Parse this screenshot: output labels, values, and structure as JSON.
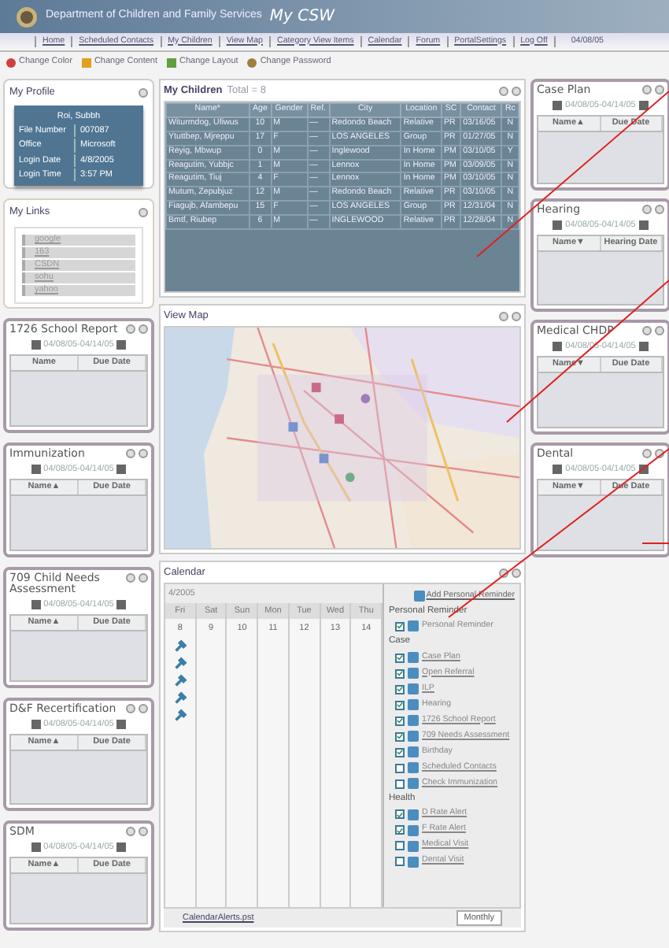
{
  "header": {
    "title": "Department of Children and Family Services",
    "app_name": "My CSW"
  },
  "nav": {
    "items": [
      "Home",
      "Scheduled Contacts",
      "My Children",
      "View Map",
      "Category View Items",
      "Calendar",
      "Forum",
      "PortalSettings",
      "Log Off"
    ],
    "date": "04/08/05"
  },
  "toolbar": [
    "Change Color",
    "Change Content",
    "Change Layout",
    "Change Password"
  ],
  "left_panels": [
    {
      "kind": "profile",
      "title": "My Profile",
      "name": "Roi, Subbh",
      "fields": [
        {
          "label": "File Number",
          "value": "007087"
        },
        {
          "label": "Office",
          "value": "Microsoft"
        },
        {
          "label": "Login Date",
          "value": "4/8/2005"
        },
        {
          "label": "Login Time",
          "value": "3:57 PM"
        }
      ]
    },
    {
      "kind": "links",
      "title": "My Links",
      "links": [
        "google",
        "163",
        "CSDN",
        "sohu",
        "yahoo"
      ]
    },
    {
      "kind": "report",
      "title": "1726 School Report",
      "range": "04/08/05-04/14/05",
      "columns": [
        "Name",
        "Due Date"
      ]
    },
    {
      "kind": "report",
      "title": "Immunization",
      "range": "04/08/05-04/14/05",
      "columns": [
        "Name▲",
        "Due Date"
      ]
    },
    {
      "kind": "report",
      "title": "709 Child Needs Assessment",
      "range": "04/08/05-04/14/05",
      "columns": [
        "Name▲",
        "Due Date"
      ]
    },
    {
      "kind": "report",
      "title": "D&F Recertification",
      "range": "04/08/05-04/14/05",
      "columns": [
        "Name▲",
        "Due Date"
      ]
    },
    {
      "kind": "report",
      "title": "SDM",
      "range": "04/08/05-04/14/05",
      "columns": [
        "Name▲",
        "Due Date"
      ]
    }
  ],
  "children": {
    "title": "My Children",
    "total": "Total = 8",
    "columns": [
      "Name*",
      "Age",
      "Gender",
      "Ref.",
      "City",
      "Location",
      "SC",
      "Contact",
      "Rc"
    ],
    "rows": [
      [
        "Witurmdog, Ufiwus",
        "10",
        "M",
        "—",
        "Redondo Beach",
        "Relative",
        "PR",
        "03/16/05",
        "N"
      ],
      [
        "Ytuttbep, Mjreppu",
        "17",
        "F",
        "—",
        "LOS ANGELES",
        "Group",
        "PR",
        "01/27/05",
        "N"
      ],
      [
        "Reyig, Mbwup",
        "0",
        "M",
        "—",
        "Inglewood",
        "In Home",
        "PM",
        "03/10/05",
        "Y"
      ],
      [
        "Reagutim, Yubbjc",
        "1",
        "M",
        "—",
        "Lennox",
        "In Home",
        "PM",
        "03/09/05",
        "N"
      ],
      [
        "Reagutim, Tiuj",
        "4",
        "F",
        "—",
        "Lennox",
        "In Home",
        "PM",
        "03/10/05",
        "N"
      ],
      [
        "Mutum, Zepubjuz",
        "12",
        "M",
        "—",
        "Redondo Beach",
        "Relative",
        "PR",
        "03/10/05",
        "N"
      ],
      [
        "Fiagujb, Afambepu",
        "15",
        "F",
        "—",
        "LOS ANGELES",
        "Group",
        "PR",
        "12/31/04",
        "N"
      ],
      [
        "Bmtf, Riubep",
        "6",
        "M",
        "—",
        "INGLEWOOD",
        "Relative",
        "PR",
        "12/28/04",
        "N"
      ]
    ]
  },
  "map": {
    "title": "View Map",
    "kind": "picture"
  },
  "calendar": {
    "title": "Calendar",
    "month": "4/2005",
    "days": [
      {
        "name": "Fri",
        "date": "8",
        "events": [
          {
            "kind": "hearing"
          },
          {
            "kind": "hearing"
          },
          {
            "kind": "hearing"
          },
          {
            "kind": "hearing"
          },
          {
            "kind": "hearing"
          }
        ]
      },
      {
        "name": "Sat",
        "date": "9"
      },
      {
        "name": "Sun",
        "date": "10"
      },
      {
        "name": "Mon",
        "date": "11"
      },
      {
        "name": "Tue",
        "date": "12"
      },
      {
        "name": "Wed",
        "date": "13"
      },
      {
        "name": "Thu",
        "date": "14"
      }
    ],
    "add_reminder": "Add Personal Reminder",
    "filters": [
      {
        "kind": "heading",
        "label": "Personal Reminder"
      },
      {
        "kind": "item",
        "label": "Personal Reminder",
        "checked": true,
        "link": false
      },
      {
        "kind": "heading",
        "label": "Case"
      },
      {
        "kind": "item",
        "label": "Case Plan",
        "checked": true,
        "link": true
      },
      {
        "kind": "item",
        "label": "Open Referral",
        "checked": true,
        "link": true
      },
      {
        "kind": "item",
        "label": "ILP",
        "checked": true,
        "link": true
      },
      {
        "kind": "item",
        "label": "Hearing",
        "checked": true,
        "link": false
      },
      {
        "kind": "item",
        "label": "1726 School Report",
        "checked": true,
        "link": true
      },
      {
        "kind": "item",
        "label": "709 Needs Assessment",
        "checked": true,
        "link": true
      },
      {
        "kind": "item",
        "label": "Birthday",
        "checked": true,
        "link": false
      },
      {
        "kind": "item",
        "label": "Scheduled Contacts",
        "checked": false,
        "link": true
      },
      {
        "kind": "item",
        "label": "Check Immunization",
        "checked": false,
        "link": true
      },
      {
        "kind": "heading",
        "label": "Health"
      },
      {
        "kind": "item",
        "label": "D Rate Alert",
        "checked": true,
        "link": true
      },
      {
        "kind": "item",
        "label": "F Rate Alert",
        "checked": true,
        "link": true
      },
      {
        "kind": "item",
        "label": "Medical Visit",
        "checked": false,
        "link": true
      },
      {
        "kind": "item",
        "label": "Dental Visit",
        "checked": false,
        "link": true
      }
    ],
    "footer_link": "CalendarAlerts.pst",
    "view_button": "Monthly"
  },
  "right_panels": [
    {
      "kind": "report",
      "title": "Case Plan",
      "range": "04/08/05-04/14/05",
      "columns": [
        "Name▲",
        "Due Date"
      ]
    },
    {
      "kind": "report",
      "title": "Hearing",
      "range": "04/08/05-04/14/05",
      "columns": [
        "Name▼",
        "Hearing Date"
      ]
    },
    {
      "kind": "report",
      "title": "Medical CHDP",
      "range": "04/08/05-04/14/05",
      "columns": [
        "Name▼",
        "Due Date"
      ]
    },
    {
      "kind": "report",
      "title": "Dental",
      "range": "04/08/05-04/14/05",
      "columns": [
        "Name▼",
        "Due Date"
      ]
    }
  ]
}
